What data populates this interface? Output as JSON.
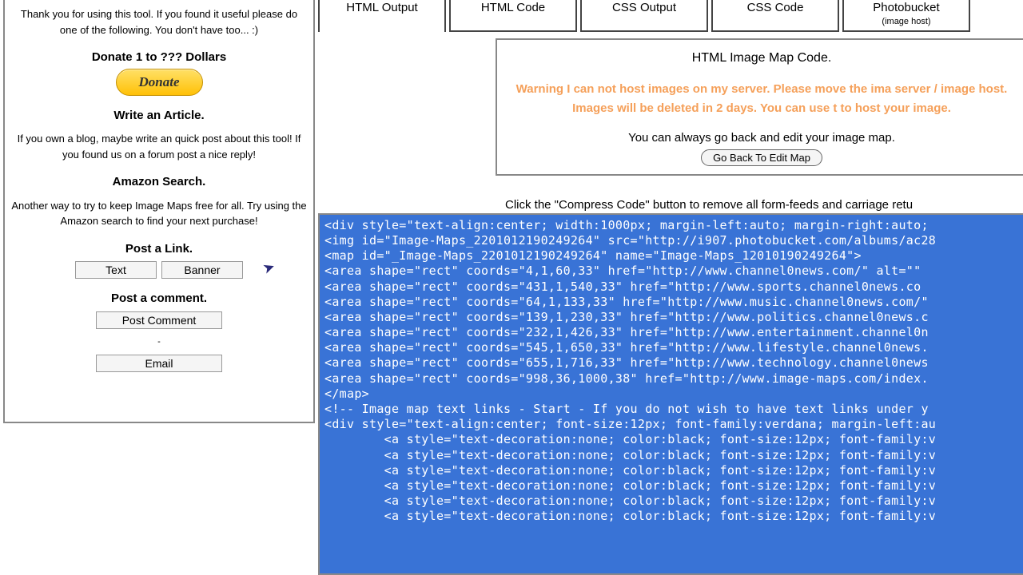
{
  "sidebar": {
    "intro": "Thank you for using this tool. If you found it useful please do one of the following. You don't have too... :)",
    "donate_heading": "Donate 1 to ??? Dollars",
    "donate_btn": "Donate",
    "article_heading": "Write an Article.",
    "article_text": "If you own a blog, maybe write an quick post about this tool! If you found us on a forum post a nice reply!",
    "amazon_heading": "Amazon Search.",
    "amazon_text": "Another way to try to keep Image Maps free for all. Try using the Amazon search to find your next purchase!",
    "link_heading": "Post a Link.",
    "text_btn": "Text",
    "banner_btn": "Banner",
    "comment_heading": "Post a comment.",
    "post_comment_btn": "Post Comment",
    "dash": "-",
    "email_btn": "Email"
  },
  "tabs": [
    {
      "label": "HTML Output",
      "sub": ""
    },
    {
      "label": "HTML Code",
      "sub": ""
    },
    {
      "label": "CSS Output",
      "sub": ""
    },
    {
      "label": "CSS Code",
      "sub": ""
    },
    {
      "label": "Photobucket",
      "sub": "(image host)"
    }
  ],
  "content": {
    "title": "HTML Image Map Code.",
    "warning": "Warning I can not host images on my server. Please move the ima server / image host. Images will be deleted in 2 days. You can use t to host your image.",
    "info": "You can always go back and edit your image map.",
    "go_back": "Go Back To Edit Map",
    "compress": "Click the \"Compress Code\" button to remove all form-feeds and carriage retu"
  },
  "code_lines": [
    "<div style=\"text-align:center; width:1000px; margin-left:auto; margin-right:auto;",
    "<img id=\"Image-Maps_2201012190249264\" src=\"http://i907.photobucket.com/albums/ac28",
    "<map id=\"_Image-Maps_2201012190249264\" name=\"Image-Maps_12010190249264\">",
    "<area shape=\"rect\" coords=\"4,1,60,33\" href=\"http://www.channel0news.com/\" alt=\"\" ",
    "<area shape=\"rect\" coords=\"431,1,540,33\" href=\"http://www.sports.channel0news.co",
    "<area shape=\"rect\" coords=\"64,1,133,33\" href=\"http://www.music.channel0news.com/\" ",
    "<area shape=\"rect\" coords=\"139,1,230,33\" href=\"http://www.politics.channel0news.c",
    "<area shape=\"rect\" coords=\"232,1,426,33\" href=\"http://www.entertainment.channel0n",
    "<area shape=\"rect\" coords=\"545,1,650,33\" href=\"http://www.lifestyle.channel0news.",
    "<area shape=\"rect\" coords=\"655,1,716,33\" href=\"http://www.technology.channel0news",
    "<area shape=\"rect\" coords=\"998,36,1000,38\" href=\"http://www.image-maps.com/index.",
    "</map>",
    "<!-- Image map text links - Start - If you do not wish to have text links under y",
    "<div style=\"text-align:center; font-size:12px; font-family:verdana; margin-left:au",
    "        <a style=\"text-decoration:none; color:black; font-size:12px; font-family:v",
    "        <a style=\"text-decoration:none; color:black; font-size:12px; font-family:v",
    "        <a style=\"text-decoration:none; color:black; font-size:12px; font-family:v",
    "        <a style=\"text-decoration:none; color:black; font-size:12px; font-family:v",
    "        <a style=\"text-decoration:none; color:black; font-size:12px; font-family:v",
    "        <a style=\"text-decoration:none; color:black; font-size:12px; font-family:v"
  ]
}
